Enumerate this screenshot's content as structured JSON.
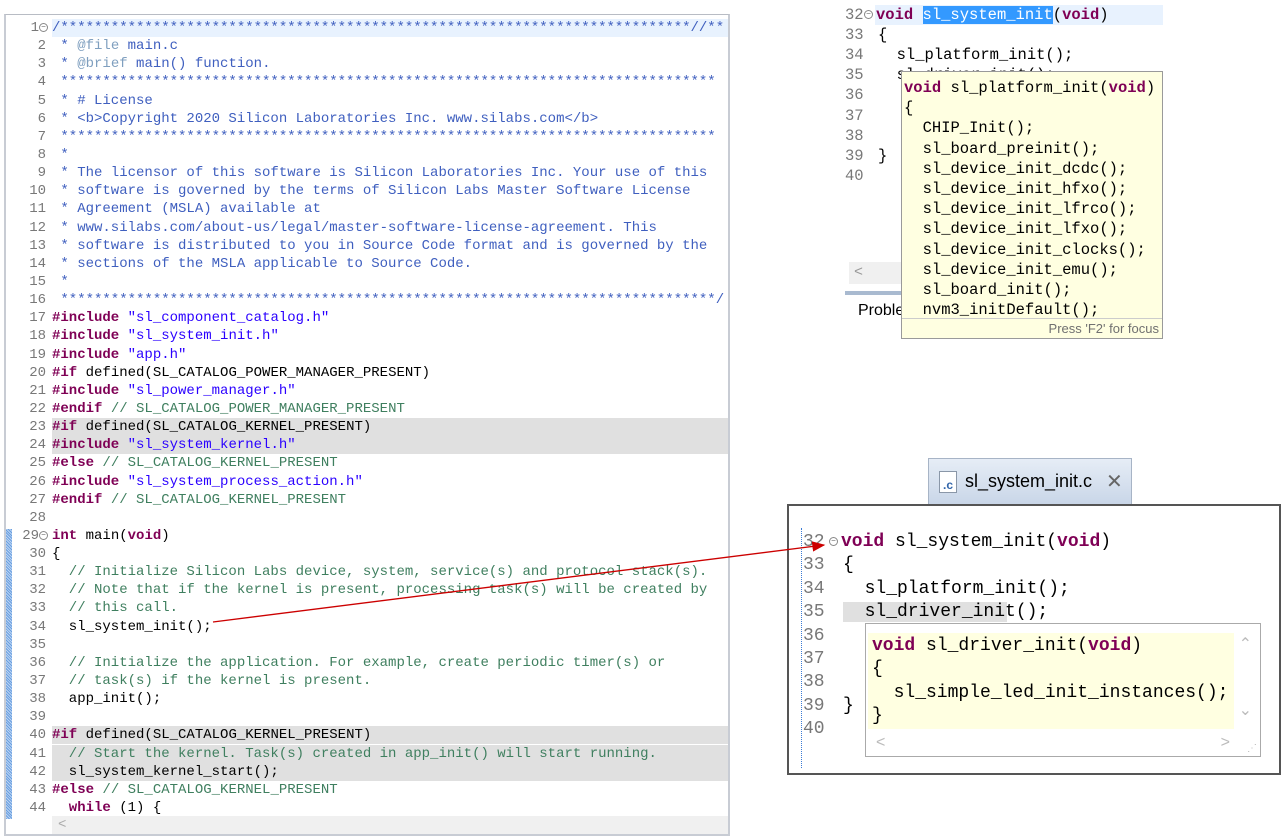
{
  "colors": {
    "keyword": "#7f0055",
    "string": "#2a00ff",
    "comment": "#3f7f5f",
    "doc_comment": "#3f5fbf",
    "annotation_arrow": "#cc0000",
    "tooltip_bg": "#ffffe1"
  },
  "main_editor": {
    "start_line": 1,
    "highlighted_lines": [
      23,
      24,
      40,
      41,
      42
    ],
    "lines": [
      [
        [
          "d",
          "/***************************************************************************//**"
        ]
      ],
      [
        [
          "d",
          " * "
        ],
        [
          "t",
          "@file"
        ],
        [
          "d",
          " main.c"
        ]
      ],
      [
        [
          "d",
          " * "
        ],
        [
          "t",
          "@brief"
        ],
        [
          "d",
          " main() function."
        ]
      ],
      [
        [
          "d",
          " ******************************************************************************"
        ]
      ],
      [
        [
          "d",
          " * # License"
        ]
      ],
      [
        [
          "d",
          " * <b>Copyright 2020 Silicon Laboratories Inc. www.silabs.com</b>"
        ]
      ],
      [
        [
          "d",
          " ******************************************************************************"
        ]
      ],
      [
        [
          "d",
          " *"
        ]
      ],
      [
        [
          "d",
          " * The licensor of this software is Silicon Laboratories Inc. Your use of this"
        ]
      ],
      [
        [
          "d",
          " * software is governed by the terms of Silicon Labs Master Software License"
        ]
      ],
      [
        [
          "d",
          " * Agreement (MSLA) available at"
        ]
      ],
      [
        [
          "d",
          " * www.silabs.com/about-us/legal/master-software-license-agreement. This"
        ]
      ],
      [
        [
          "d",
          " * software is distributed to you in Source Code format and is governed by the"
        ]
      ],
      [
        [
          "d",
          " * sections of the MSLA applicable to Source Code."
        ]
      ],
      [
        [
          "d",
          " *"
        ]
      ],
      [
        [
          "d",
          " ******************************************************************************/"
        ]
      ],
      [
        [
          "k",
          "#include"
        ],
        [
          "n",
          " "
        ],
        [
          "s",
          "\"sl_component_catalog.h\""
        ]
      ],
      [
        [
          "k",
          "#include"
        ],
        [
          "n",
          " "
        ],
        [
          "s",
          "\"sl_system_init.h\""
        ]
      ],
      [
        [
          "k",
          "#include"
        ],
        [
          "n",
          " "
        ],
        [
          "s",
          "\"app.h\""
        ]
      ],
      [
        [
          "k",
          "#if"
        ],
        [
          "n",
          " defined(SL_CATALOG_POWER_MANAGER_PRESENT)"
        ]
      ],
      [
        [
          "k",
          "#include"
        ],
        [
          "n",
          " "
        ],
        [
          "s",
          "\"sl_power_manager.h\""
        ]
      ],
      [
        [
          "k",
          "#endif"
        ],
        [
          "c",
          " // SL_CATALOG_POWER_MANAGER_PRESENT"
        ]
      ],
      [
        [
          "k",
          "#if"
        ],
        [
          "n",
          " defined(SL_CATALOG_KERNEL_PRESENT)"
        ]
      ],
      [
        [
          "k",
          "#include"
        ],
        [
          "n",
          " "
        ],
        [
          "s",
          "\"sl_system_kernel.h\""
        ]
      ],
      [
        [
          "k",
          "#else"
        ],
        [
          "c",
          " // SL_CATALOG_KERNEL_PRESENT"
        ]
      ],
      [
        [
          "k",
          "#include"
        ],
        [
          "n",
          " "
        ],
        [
          "s",
          "\"sl_system_process_action.h\""
        ]
      ],
      [
        [
          "k",
          "#endif"
        ],
        [
          "c",
          " // SL_CATALOG_KERNEL_PRESENT"
        ]
      ],
      [],
      [
        [
          "k",
          "int"
        ],
        [
          "n",
          " main("
        ],
        [
          "k",
          "void"
        ],
        [
          "n",
          ")"
        ]
      ],
      [
        [
          "n",
          "{"
        ]
      ],
      [
        [
          "c",
          "  // Initialize Silicon Labs device, system, service(s) and protocol stack(s)."
        ]
      ],
      [
        [
          "c",
          "  // Note that if the kernel is present, processing task(s) will be created by"
        ]
      ],
      [
        [
          "c",
          "  // this call."
        ]
      ],
      [
        [
          "n",
          "  sl_system_init();"
        ]
      ],
      [],
      [
        [
          "c",
          "  // Initialize the application. For example, create periodic timer(s) or"
        ]
      ],
      [
        [
          "c",
          "  // task(s) if the kernel is present."
        ]
      ],
      [
        [
          "n",
          "  app_init();"
        ]
      ],
      [],
      [
        [
          "k",
          "#if"
        ],
        [
          "n",
          " defined(SL_CATALOG_KERNEL_PRESENT)"
        ]
      ],
      [
        [
          "c",
          "  // Start the kernel. Task(s) created in app_init() will start running."
        ]
      ],
      [
        [
          "n",
          "  sl_system_kernel_start();"
        ]
      ],
      [
        [
          "k",
          "#else"
        ],
        [
          "c",
          " // SL_CATALOG_KERNEL_PRESENT"
        ]
      ],
      [
        [
          "k",
          "  while"
        ],
        [
          "n",
          " (1) {"
        ]
      ]
    ],
    "scroll_left": "<"
  },
  "top_snippet": {
    "lines": [
      {
        "num": "32",
        "seg": [
          [
            "k",
            "void"
          ],
          [
            "n",
            " "
          ],
          [
            "sel",
            "sl_system_init"
          ],
          [
            "n",
            "("
          ],
          [
            "k",
            "void"
          ],
          [
            "n",
            ")"
          ]
        ]
      },
      {
        "num": "33",
        "seg": [
          [
            "n",
            "{"
          ]
        ]
      },
      {
        "num": "34",
        "seg": [
          [
            "n",
            "  sl_platform_init();"
          ]
        ]
      },
      {
        "num": "35",
        "seg": [
          [
            "n",
            "  sl_driver_init();"
          ]
        ]
      },
      {
        "num": "36",
        "seg": []
      },
      {
        "num": "37",
        "seg": []
      },
      {
        "num": "38",
        "seg": []
      },
      {
        "num": "39",
        "seg": [
          [
            "n",
            "}"
          ]
        ]
      },
      {
        "num": "40",
        "seg": []
      }
    ],
    "scroll_left": "<",
    "problems_tab": "Proble",
    "tooltip": {
      "lines": [
        [
          [
            "k",
            "void"
          ],
          [
            "n",
            " sl_platform_init("
          ],
          [
            "k",
            "void"
          ],
          [
            "n",
            ")"
          ]
        ],
        [
          [
            "n",
            "{"
          ]
        ],
        [
          [
            "n",
            "  CHIP_Init();"
          ]
        ],
        [
          [
            "n",
            "  sl_board_preinit();"
          ]
        ],
        [
          [
            "n",
            "  sl_device_init_dcdc();"
          ]
        ],
        [
          [
            "n",
            "  sl_device_init_hfxo();"
          ]
        ],
        [
          [
            "n",
            "  sl_device_init_lfrco();"
          ]
        ],
        [
          [
            "n",
            "  sl_device_init_lfxo();"
          ]
        ],
        [
          [
            "n",
            "  sl_device_init_clocks();"
          ]
        ],
        [
          [
            "n",
            "  sl_device_init_emu();"
          ]
        ],
        [
          [
            "n",
            "  sl_board_init();"
          ]
        ],
        [
          [
            "n",
            "  nvm3_initDefault();"
          ]
        ]
      ],
      "footer": "Press 'F2' for focus"
    }
  },
  "bottom_editor": {
    "tab": {
      "label": "sl_system_init.c",
      "icon": "c-file-icon",
      "close": "close-icon"
    },
    "lines": [
      {
        "num": "32",
        "seg": [
          [
            "k",
            "void"
          ],
          [
            "n",
            " sl_system_init("
          ],
          [
            "k",
            "void"
          ],
          [
            "n",
            ")"
          ]
        ]
      },
      {
        "num": "33",
        "seg": [
          [
            "n",
            "{"
          ]
        ]
      },
      {
        "num": "34",
        "seg": [
          [
            "n",
            "  sl_platform_init();"
          ]
        ]
      },
      {
        "num": "35",
        "seg": [
          [
            "n",
            "  sl_driver_init();"
          ]
        ]
      },
      {
        "num": "36",
        "seg": []
      },
      {
        "num": "37",
        "seg": []
      },
      {
        "num": "38",
        "seg": []
      },
      {
        "num": "39",
        "seg": [
          [
            "n",
            "}"
          ]
        ]
      },
      {
        "num": "40",
        "seg": []
      }
    ],
    "tooltip": {
      "lines": [
        [
          [
            "k",
            "void"
          ],
          [
            "n",
            " sl_driver_init("
          ],
          [
            "k",
            "void"
          ],
          [
            "n",
            ")"
          ]
        ],
        [
          [
            "n",
            "{"
          ]
        ],
        [
          [
            "n",
            "  sl_simple_led_init_instances();"
          ]
        ],
        [
          [
            "n",
            "}"
          ]
        ]
      ],
      "scroll_up": "⌃",
      "scroll_down": "⌄",
      "scroll_left": "<",
      "scroll_right": ">"
    }
  }
}
